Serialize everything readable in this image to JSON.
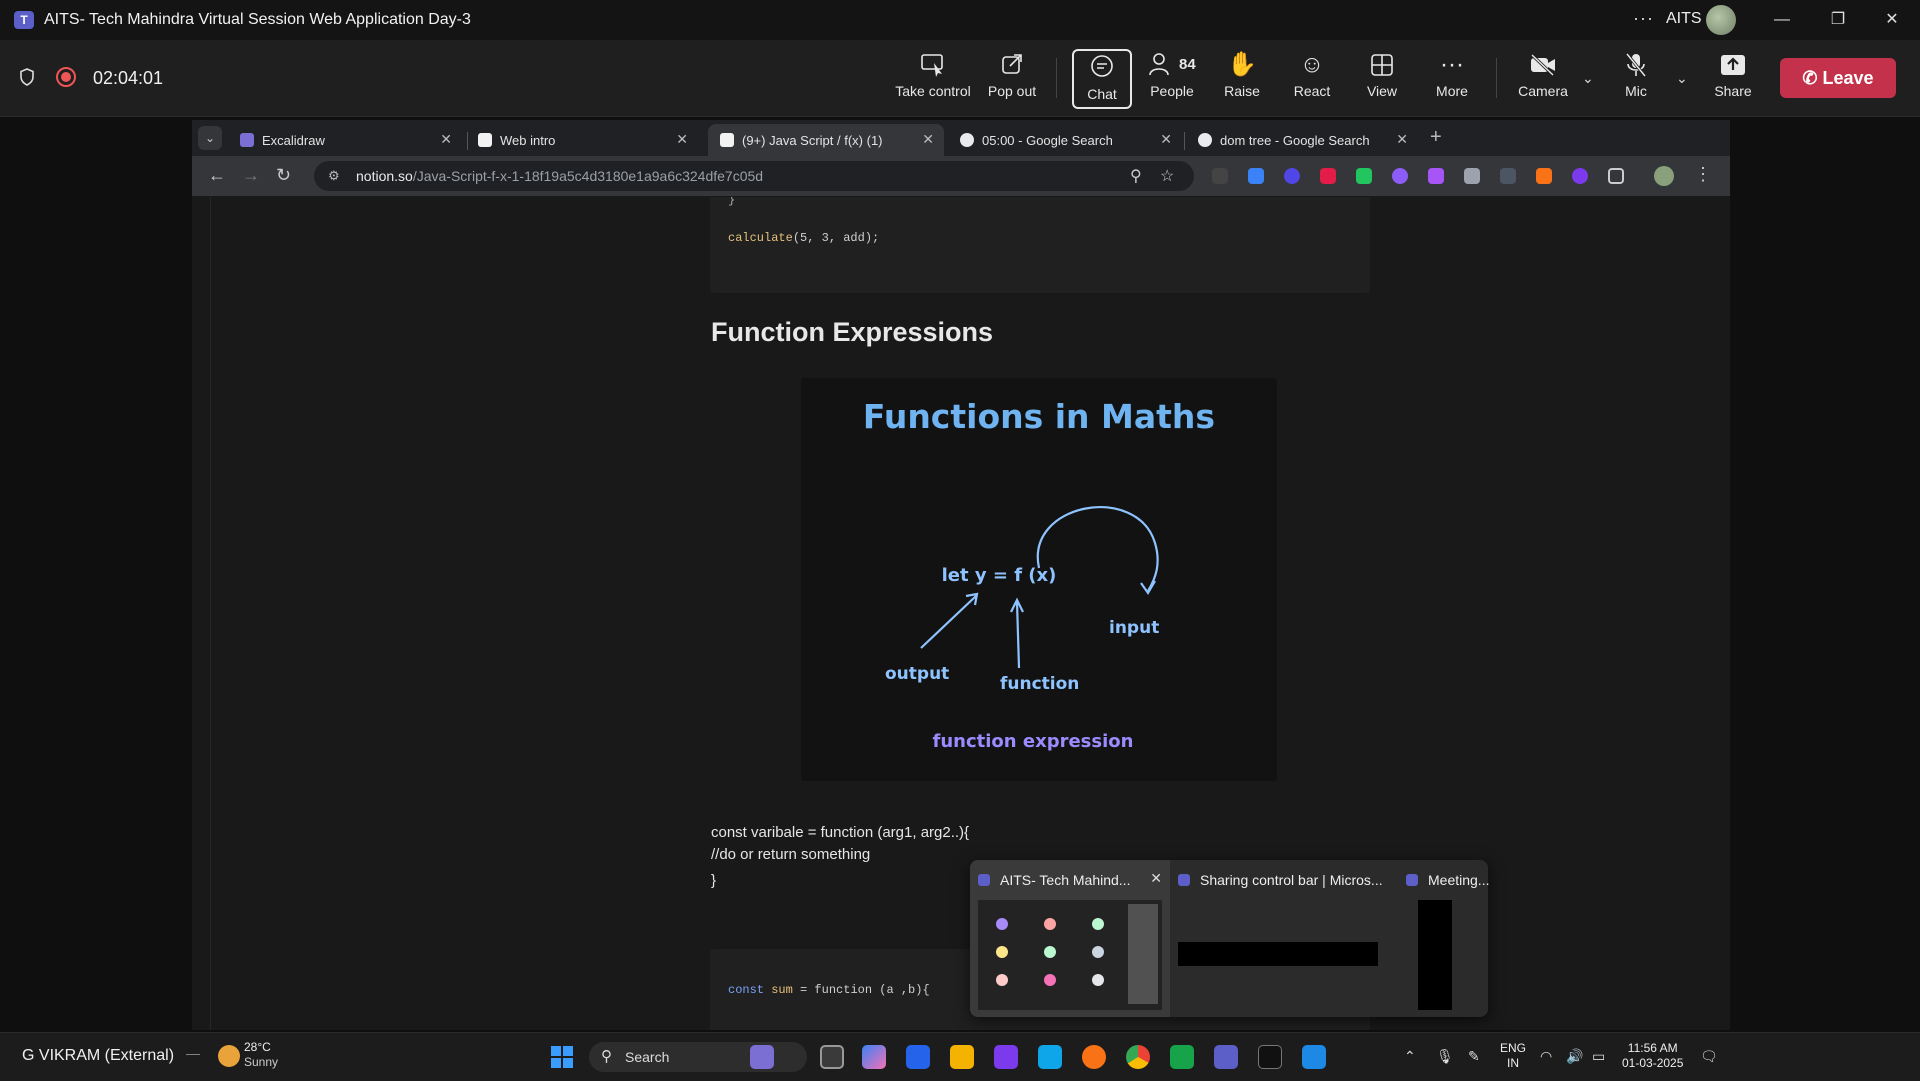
{
  "window": {
    "title": "AITS- Tech Mahindra Virtual Session Web Application Day-3",
    "org": "AITS",
    "minimize": "—",
    "restore": "❐",
    "close": "✕"
  },
  "meeting": {
    "timer": "02:04:01",
    "controls": [
      {
        "label": "Take control",
        "icon": "take-control-icon"
      },
      {
        "label": "Pop out",
        "icon": "pop-out-icon"
      },
      {
        "label": "Chat",
        "icon": "chat-icon"
      },
      {
        "label": "People",
        "icon": "people-icon",
        "count": "84"
      },
      {
        "label": "Raise",
        "icon": "raise-hand-icon"
      },
      {
        "label": "React",
        "icon": "react-icon"
      },
      {
        "label": "View",
        "icon": "view-icon"
      },
      {
        "label": "More",
        "icon": "more-icon"
      },
      {
        "label": "Camera",
        "icon": "camera-off-icon"
      },
      {
        "label": "Mic",
        "icon": "mic-off-icon"
      },
      {
        "label": "Share",
        "icon": "share-icon"
      }
    ],
    "leave_label": "Leave",
    "colors": {
      "leave": "#c4314b",
      "recording": "#e55555"
    }
  },
  "browser": {
    "tabs": [
      {
        "label": "Excalidraw"
      },
      {
        "label": "Web intro"
      },
      {
        "label": "(9+) Java Script / f(x) (1)"
      },
      {
        "label": "05:00 - Google Search"
      },
      {
        "label": "dom tree - Google Search"
      }
    ],
    "url_host": "notion.so",
    "url_path": "/Java-Script-f-x-1-18f19a5c4d3180e1a9a6c324dfe7c05d"
  },
  "page": {
    "code_top": {
      "fn": "calculate",
      "rest": "(5, 3, add);",
      "brace": "}"
    },
    "heading": "Function Expressions",
    "illustration": {
      "title": "Functions in Maths",
      "expr": "let y = f (x)",
      "output": "output",
      "function": "function",
      "input": "input",
      "caption": "function expression"
    },
    "text_lines": [
      "const varibale = function (arg1, arg2..){",
      "//do or return something",
      "}"
    ],
    "code_bottom": {
      "kw": "const",
      "name": "sum",
      "rest": " = function (a ,b){"
    }
  },
  "thumbnails": [
    {
      "label": "AITS- Tech Mahind..."
    },
    {
      "label": "Sharing control bar | Micros..."
    },
    {
      "label": "Meeting..."
    }
  ],
  "taskbar": {
    "presenter": "G VIKRAM (External)",
    "weather_temp": "28°C",
    "weather_desc": "Sunny",
    "search_label": "Search",
    "lang_1": "ENG",
    "lang_2": "IN",
    "time": "11:56 AM",
    "date": "01-03-2025"
  }
}
